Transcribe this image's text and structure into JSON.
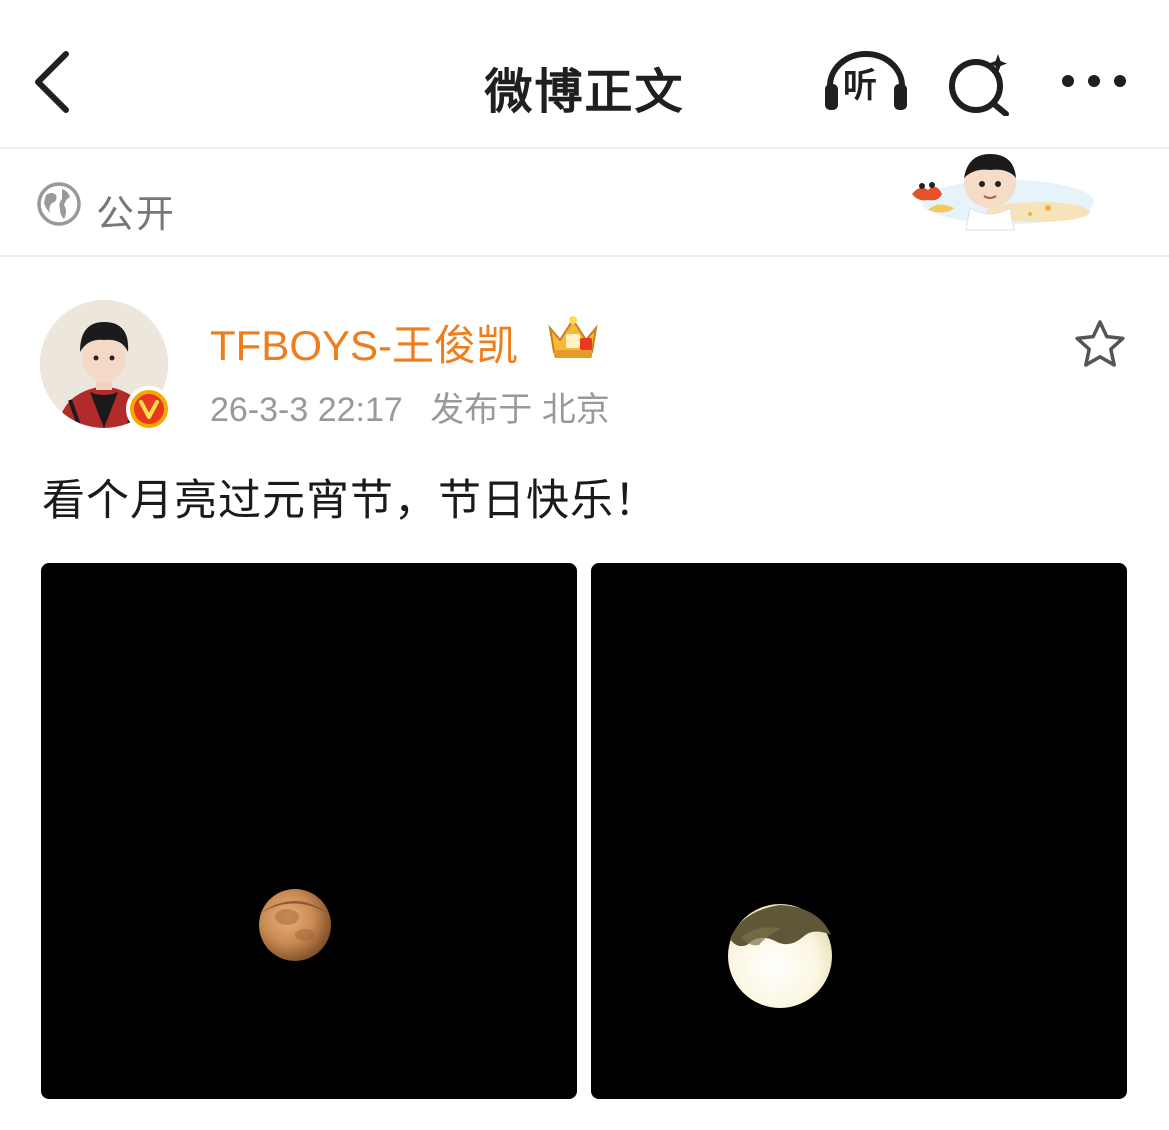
{
  "header": {
    "title": "微博正文",
    "listen_label": "听"
  },
  "visibility": {
    "label": "公开"
  },
  "post": {
    "author": "TFBOYS-王俊凯",
    "time": "26-3-3 22:17",
    "location": "发布于 北京",
    "text": "看个月亮过元宵节，节日快乐！",
    "verified_badge": "V",
    "images": [
      {
        "alt": "moon-photo-1"
      },
      {
        "alt": "moon-photo-2"
      }
    ]
  },
  "colors": {
    "username": "#f07c1a",
    "meta": "#999999",
    "badge": "#f2a900",
    "photo_bg": "#000000"
  },
  "icons": [
    "back-icon",
    "listen-icon",
    "search-icon",
    "more-icon",
    "globe-icon",
    "star-icon",
    "crown-icon",
    "verified-icon"
  ]
}
